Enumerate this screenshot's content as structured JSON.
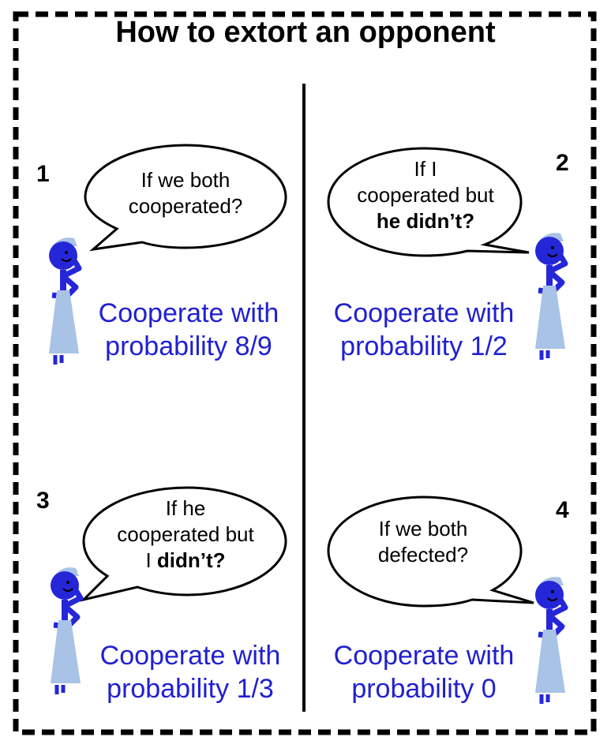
{
  "title": "How to extort an opponent",
  "colors": {
    "figure_dark": "#2626d9",
    "figure_light": "#a9c3e6",
    "caption": "#2020d0"
  },
  "panels": [
    {
      "number": "1",
      "bubble": [
        {
          "text": "If we both"
        },
        {
          "text": "cooperated?"
        }
      ],
      "caption": [
        "Cooperate with",
        "probability 8/9"
      ]
    },
    {
      "number": "2",
      "bubble": [
        {
          "text": "If I"
        },
        {
          "text": "cooperated but"
        },
        {
          "text": "he didn’t?",
          "bold": true
        }
      ],
      "caption": [
        "Cooperate with",
        "probability 1/2"
      ]
    },
    {
      "number": "3",
      "bubble": [
        {
          "text": "If he"
        },
        {
          "text": "cooperated but"
        },
        {
          "text": "I ",
          "bold_part": "didn’t?"
        }
      ],
      "caption": [
        "Cooperate with",
        "probability 1/3"
      ]
    },
    {
      "number": "4",
      "bubble": [
        {
          "text": "If we both"
        },
        {
          "text": "defected?"
        }
      ],
      "caption": [
        "Cooperate with",
        "probability 0"
      ]
    }
  ]
}
